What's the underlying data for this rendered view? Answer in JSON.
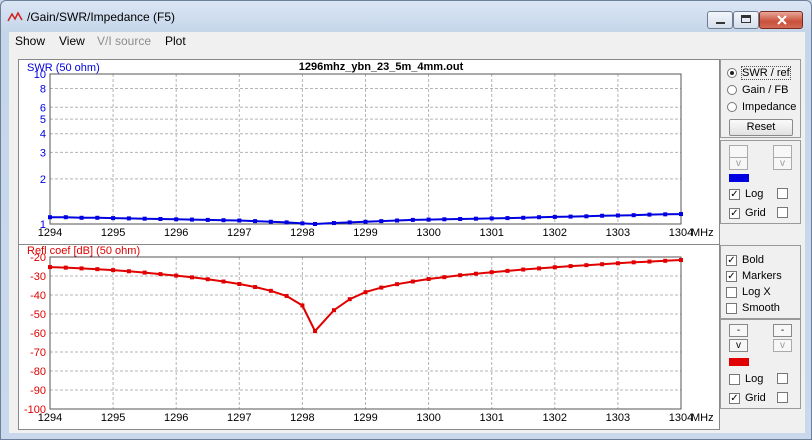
{
  "window": {
    "title": "/Gain/SWR/Impedance (F5)"
  },
  "colors": {
    "swr": "#0000e0",
    "refl": "#e00000",
    "grid": "#b4b4b4"
  },
  "menu": {
    "items": [
      "Show",
      "View",
      "V/I source",
      "Plot"
    ],
    "disabled": [
      false,
      false,
      true,
      false
    ]
  },
  "top_panel": {
    "radios": [
      {
        "label": "SWR / ref",
        "checked": true
      },
      {
        "label": "Gain / FB",
        "checked": false
      },
      {
        "label": "Impedance",
        "checked": false
      }
    ],
    "reset_label": "Reset",
    "v_label": "v",
    "log_label": "Log",
    "grid_label": "Grid",
    "log_checked": true,
    "grid_checked": true
  },
  "bottom_panel": {
    "options": [
      {
        "label": "Bold",
        "checked": true
      },
      {
        "label": "Markers",
        "checked": true
      },
      {
        "label": "Log X",
        "checked": false
      },
      {
        "label": "Smooth",
        "checked": false
      }
    ],
    "minus_label": "-",
    "v_label": "v",
    "log_label": "Log",
    "grid_label": "Grid",
    "log_checked": false,
    "grid_checked": true
  },
  "chart_data": [
    {
      "type": "line",
      "title": "1296mhz_ybn_23_5m_4mm.out",
      "ylabel": "SWR (50 ohm)",
      "xunit": "MHz",
      "yscale": "log",
      "xlim": [
        1294,
        1304
      ],
      "ylim": [
        1,
        10
      ],
      "xticks": [
        1294,
        1295,
        1296,
        1297,
        1298,
        1299,
        1300,
        1301,
        1302,
        1303,
        1304
      ],
      "yticks": [
        1,
        2,
        3,
        4,
        5,
        6,
        8,
        10
      ],
      "grid": true,
      "series": [
        {
          "x": [
            1294.0,
            1294.25,
            1294.5,
            1294.75,
            1295.0,
            1295.25,
            1295.5,
            1295.75,
            1296.0,
            1296.25,
            1296.5,
            1296.75,
            1297.0,
            1297.25,
            1297.5,
            1297.75,
            1298.0,
            1298.2,
            1298.5,
            1298.75,
            1299.0,
            1299.25,
            1299.5,
            1299.75,
            1300.0,
            1300.25,
            1300.5,
            1300.75,
            1301.0,
            1301.25,
            1301.5,
            1301.75,
            1302.0,
            1302.25,
            1302.5,
            1302.75,
            1303.0,
            1303.25,
            1303.5,
            1303.75,
            1304.0
          ],
          "y": [
            1.11,
            1.11,
            1.1,
            1.1,
            1.095,
            1.09,
            1.085,
            1.08,
            1.075,
            1.07,
            1.065,
            1.06,
            1.055,
            1.045,
            1.035,
            1.025,
            1.01,
            1.0,
            1.015,
            1.025,
            1.035,
            1.045,
            1.055,
            1.065,
            1.07,
            1.075,
            1.08,
            1.085,
            1.09,
            1.095,
            1.1,
            1.11,
            1.115,
            1.12,
            1.125,
            1.135,
            1.14,
            1.145,
            1.155,
            1.16,
            1.165
          ]
        }
      ]
    },
    {
      "type": "line",
      "ylabel": "Refl coef [dB] (50 ohm)",
      "xunit": "MHz",
      "xlim": [
        1294,
        1304
      ],
      "ylim": [
        -100,
        -20
      ],
      "xticks": [
        1294,
        1295,
        1296,
        1297,
        1298,
        1299,
        1300,
        1301,
        1302,
        1303,
        1304
      ],
      "yticks": [
        -20,
        -30,
        -40,
        -50,
        -60,
        -70,
        -80,
        -90,
        -100
      ],
      "grid": true,
      "series": [
        {
          "x": [
            1294.0,
            1294.25,
            1294.5,
            1294.75,
            1295.0,
            1295.25,
            1295.5,
            1295.75,
            1296.0,
            1296.25,
            1296.5,
            1296.75,
            1297.0,
            1297.25,
            1297.5,
            1297.75,
            1298.0,
            1298.2,
            1298.5,
            1298.75,
            1299.0,
            1299.25,
            1299.5,
            1299.75,
            1300.0,
            1300.25,
            1300.5,
            1300.75,
            1301.0,
            1301.25,
            1301.5,
            1301.75,
            1302.0,
            1302.25,
            1302.5,
            1302.75,
            1303.0,
            1303.25,
            1303.5,
            1303.75,
            1304.0
          ],
          "y": [
            -25.3,
            -25.6,
            -26.0,
            -26.4,
            -26.9,
            -27.5,
            -28.2,
            -29.0,
            -29.8,
            -30.7,
            -31.7,
            -32.9,
            -34.2,
            -35.8,
            -37.8,
            -40.5,
            -45.5,
            -59.0,
            -48.0,
            -42.2,
            -38.5,
            -36.1,
            -34.3,
            -32.9,
            -31.6,
            -30.6,
            -29.6,
            -28.8,
            -28.0,
            -27.3,
            -26.6,
            -26.0,
            -25.4,
            -24.8,
            -24.3,
            -23.8,
            -23.3,
            -22.8,
            -22.4,
            -22.0,
            -21.6
          ]
        }
      ]
    }
  ]
}
